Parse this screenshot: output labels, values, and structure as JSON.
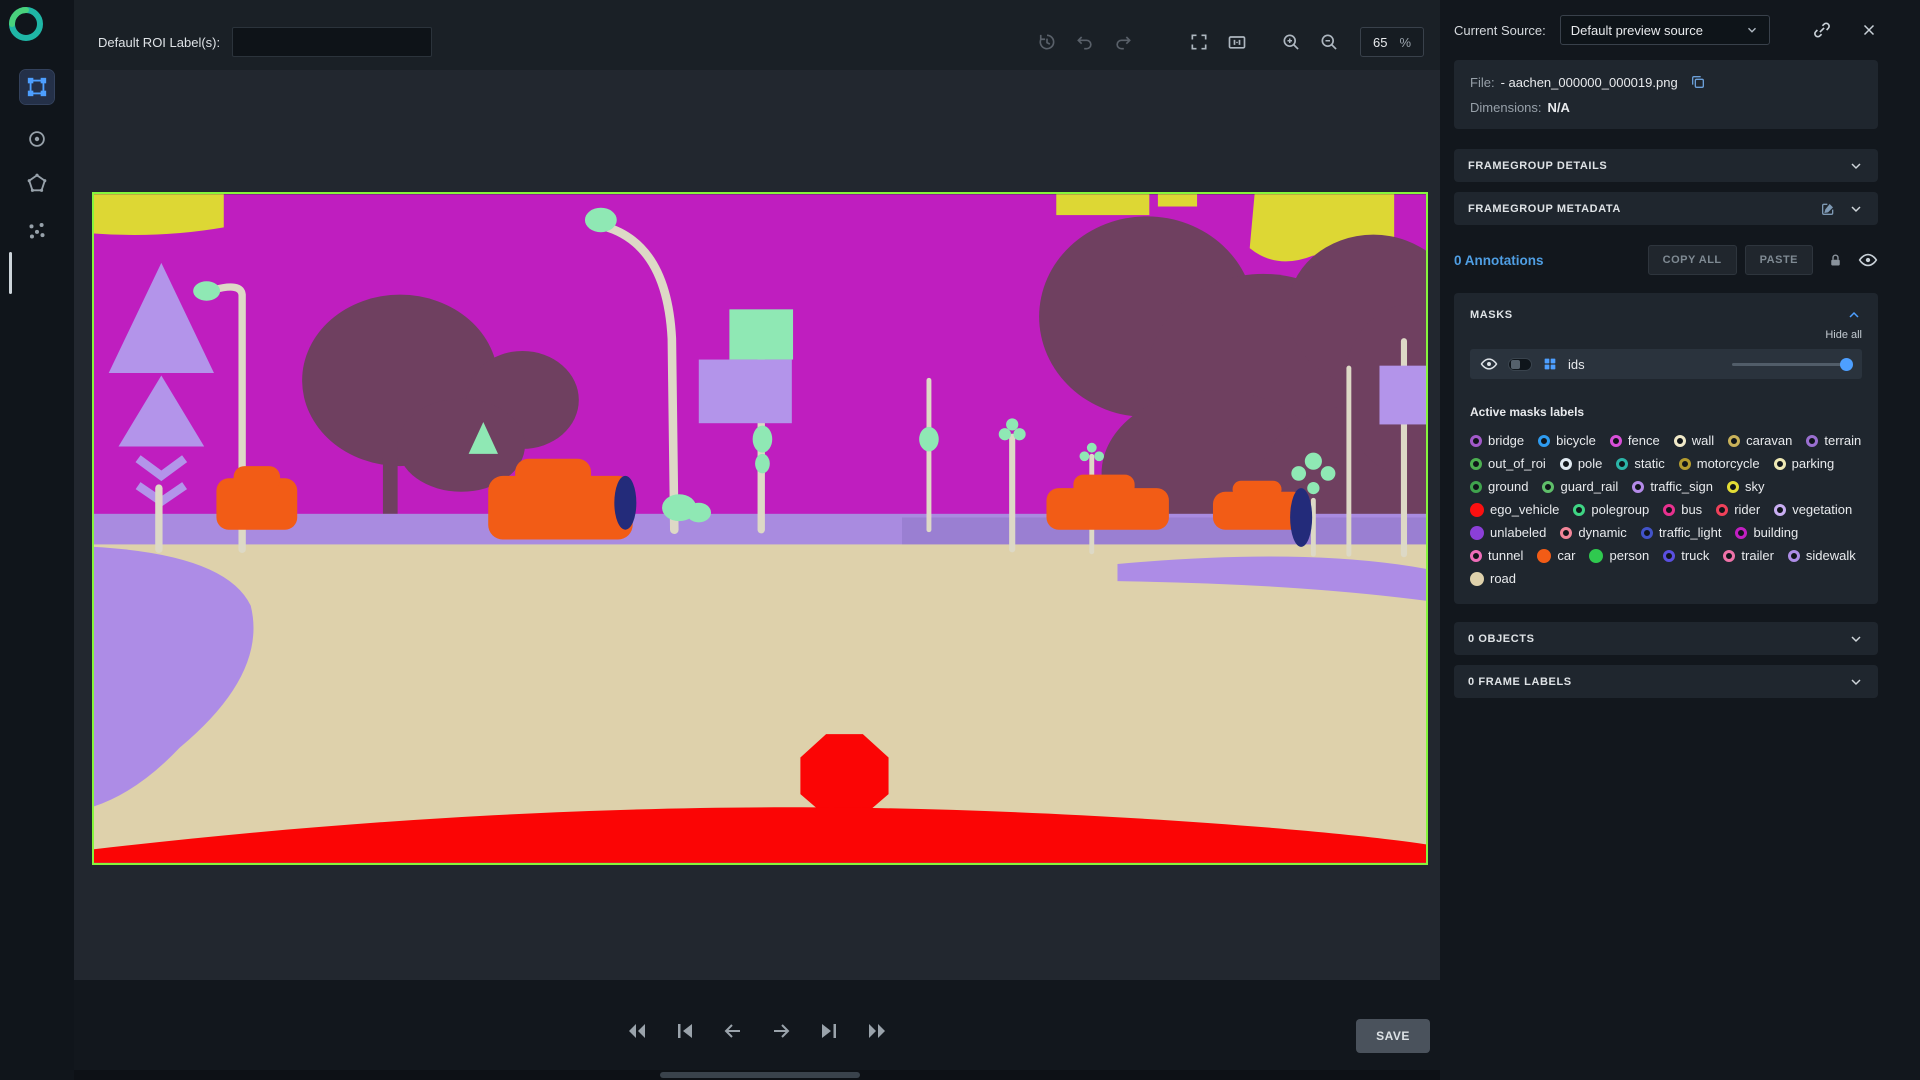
{
  "colors": {
    "accent": "#4d9fff",
    "image_border": "#86f53c",
    "annotation_link": "#4f9ee3"
  },
  "topbar": {
    "roi_label": "Default ROI Label(s):",
    "roi_value": "",
    "zoom_value": "65",
    "zoom_percent": "%"
  },
  "source": {
    "label": "Current Source:",
    "selected": "Default preview source"
  },
  "file_info": {
    "file_label": "File:",
    "file_name": "- aachen_000000_000019.png",
    "dimensions_label": "Dimensions:",
    "dimensions_value": "N/A"
  },
  "sections": {
    "framegroup_details": "FRAMEGROUP DETAILS",
    "framegroup_metadata": "FRAMEGROUP METADATA",
    "objects": "0 OBJECTS",
    "frame_labels": "0 FRAME LABELS"
  },
  "annotations": {
    "count": "0 Annotations",
    "copy_all": "COPY ALL",
    "paste": "PASTE"
  },
  "masks": {
    "title": "MASKS",
    "hide_all": "Hide all",
    "ids_label": "ids",
    "active_title": "Active masks labels",
    "labels": [
      {
        "label": "bridge",
        "color": "#a259c9"
      },
      {
        "label": "bicycle",
        "color": "#2e9bf0"
      },
      {
        "label": "fence",
        "color": "#d84fd8"
      },
      {
        "label": "wall",
        "color": "#efe8c8"
      },
      {
        "label": "caravan",
        "color": "#c9b25a"
      },
      {
        "label": "terrain",
        "color": "#9a6fd0"
      },
      {
        "label": "out_of_roi",
        "color": "#4caf50"
      },
      {
        "label": "pole",
        "color": "#dfe8f0"
      },
      {
        "label": "static",
        "color": "#2bb5a8"
      },
      {
        "label": "motorcycle",
        "color": "#b39b2e"
      },
      {
        "label": "parking",
        "color": "#efe9b4"
      },
      {
        "label": "ground",
        "color": "#3fa34d"
      },
      {
        "label": "guard_rail",
        "color": "#5fbf6a"
      },
      {
        "label": "traffic_sign",
        "color": "#b48ae8"
      },
      {
        "label": "sky",
        "color": "#e3dd35"
      },
      {
        "label": "ego_vehicle",
        "color": "#fb1010",
        "filled": true
      },
      {
        "label": "polegroup",
        "color": "#3fd584"
      },
      {
        "label": "bus",
        "color": "#e8318f"
      },
      {
        "label": "rider",
        "color": "#f0415a"
      },
      {
        "label": "vegetation",
        "color": "#c9aef2"
      },
      {
        "label": "unlabeled",
        "color": "#8b3fd8",
        "filled": true
      },
      {
        "label": "dynamic",
        "color": "#f28598"
      },
      {
        "label": "traffic_light",
        "color": "#4253c9"
      },
      {
        "label": "building",
        "color": "#c21fc2"
      },
      {
        "label": "tunnel",
        "color": "#ef6cb8"
      },
      {
        "label": "car",
        "color": "#f25c16",
        "filled": true
      },
      {
        "label": "person",
        "color": "#2fc94f",
        "filled": true
      },
      {
        "label": "truck",
        "color": "#5a4fe0"
      },
      {
        "label": "trailer",
        "color": "#ef72a8"
      },
      {
        "label": "sidewalk",
        "color": "#ad8ce6"
      },
      {
        "label": "road",
        "color": "#ded1ab",
        "filled": true
      }
    ]
  },
  "footer": {
    "save": "SAVE"
  }
}
